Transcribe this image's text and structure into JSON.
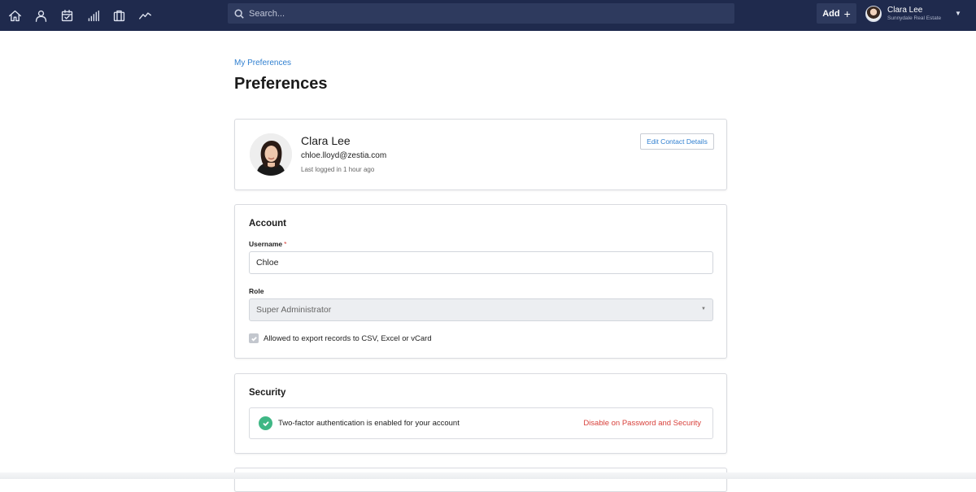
{
  "topbar": {
    "icons": [
      "home-icon",
      "contacts-icon",
      "calendar-icon",
      "reports-icon",
      "properties-icon",
      "activity-icon"
    ],
    "search_placeholder": "Search...",
    "add_label": "Add",
    "user_name": "Clara Lee",
    "user_org": "Sunnydale Real Estate",
    "colors": {
      "bar": "#1f2a4d",
      "field": "#2e3a5e"
    }
  },
  "breadcrumb": "My Preferences",
  "page_title": "Preferences",
  "profile": {
    "name": "Clara Lee",
    "email": "chloe.lloyd@zestia.com",
    "last_login": "Last logged in 1 hour ago",
    "edit_button": "Edit Contact Details"
  },
  "account": {
    "title": "Account",
    "username_label": "Username",
    "required_mark": "*",
    "username_value": "Chloe",
    "role_label": "Role",
    "role_value": "Super Administrator",
    "export_checkbox_label": "Allowed to export records to CSV, Excel or vCard",
    "export_checked": true
  },
  "security": {
    "title": "Security",
    "twofa_text": "Two-factor authentication is enabled for your account",
    "twofa_link": "Disable on Password and Security",
    "colors": {
      "success": "#3fb785",
      "danger": "#d8413b"
    }
  }
}
